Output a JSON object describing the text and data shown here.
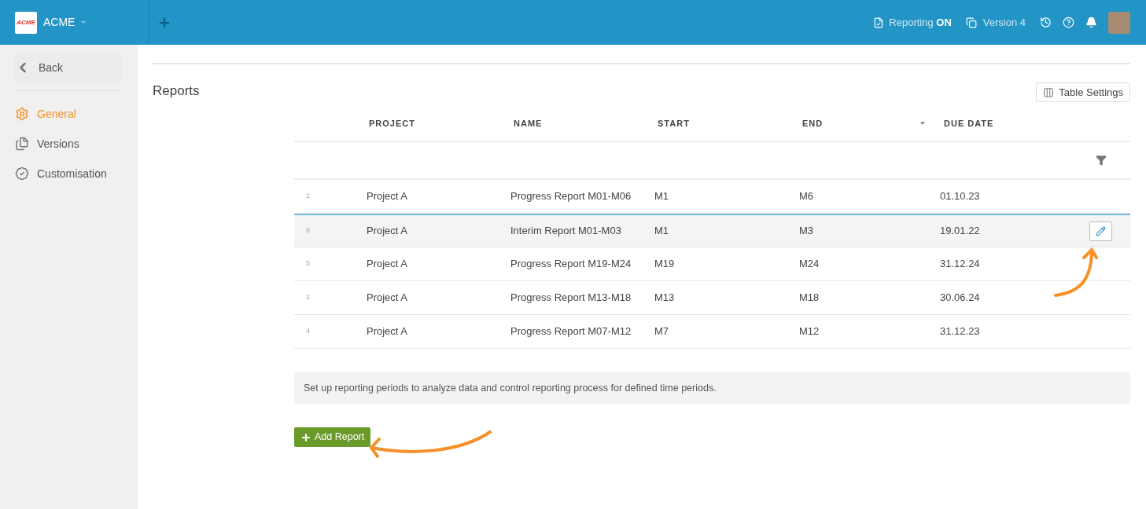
{
  "header": {
    "logo": "ACME",
    "org": "ACME",
    "reporting_label": "Reporting",
    "reporting_state": "ON",
    "version": "Version 4"
  },
  "sidebar": {
    "back": "Back",
    "items": [
      {
        "label": "General",
        "selected": true
      },
      {
        "label": "Versions",
        "selected": false
      },
      {
        "label": "Customisation",
        "selected": false
      }
    ]
  },
  "page": {
    "title": "Reports",
    "table_settings": "Table Settings"
  },
  "table": {
    "columns": [
      "PROJECT",
      "NAME",
      "START",
      "END",
      "DUE DATE"
    ],
    "rows": [
      {
        "index": "1",
        "project": "Project A",
        "name": "Progress Report M01-M06",
        "start": "M1",
        "end": "M6",
        "due": "01.10.23",
        "selected": false
      },
      {
        "index": "9",
        "project": "Project A",
        "name": "Interim Report M01-M03",
        "start": "M1",
        "end": "M3",
        "due": "19.01.22",
        "selected": true
      },
      {
        "index": "5",
        "project": "Project A",
        "name": "Progress Report M19-M24",
        "start": "M19",
        "end": "M24",
        "due": "31.12.24",
        "selected": false
      },
      {
        "index": "2",
        "project": "Project A",
        "name": "Progress Report M13-M18",
        "start": "M13",
        "end": "M18",
        "due": "30.06.24",
        "selected": false
      },
      {
        "index": "4",
        "project": "Project A",
        "name": "Progress Report M07-M12",
        "start": "M7",
        "end": "M12",
        "due": "31.12.23",
        "selected": false
      }
    ]
  },
  "info": "Set up reporting periods to analyze data and control reporting process for defined time periods.",
  "add_button": "Add Report"
}
